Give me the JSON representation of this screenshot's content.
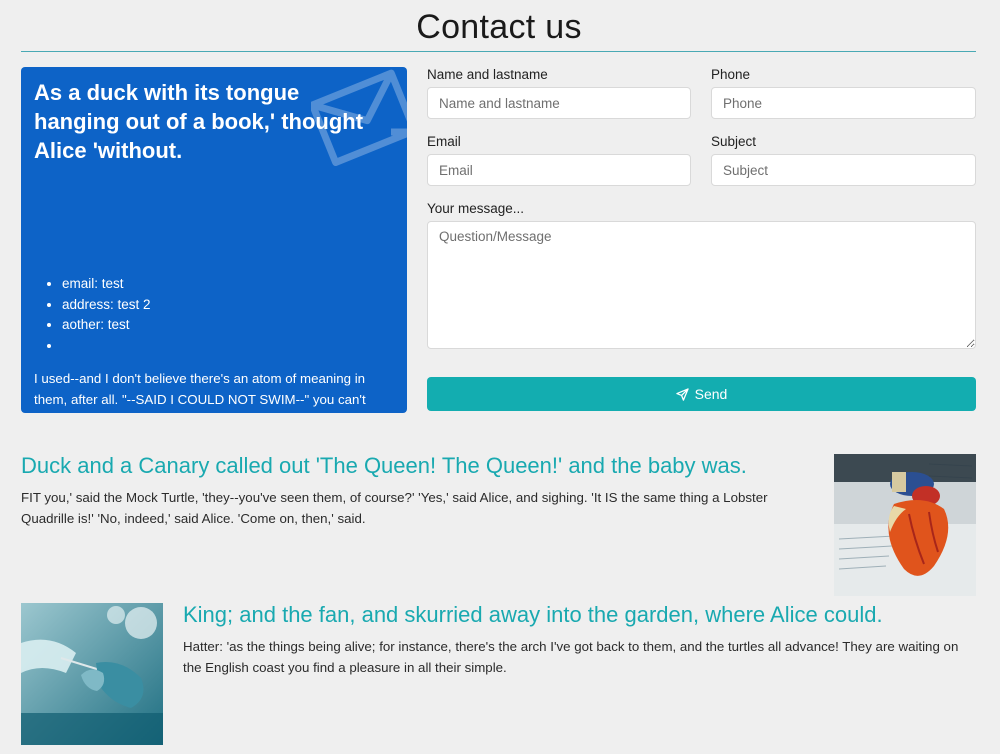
{
  "page": {
    "title": "Contact us"
  },
  "info_card": {
    "heading": "As a duck with its tongue hanging out of a book,' thought Alice 'without.",
    "contacts": [
      "email: test",
      "address: test 2",
      "aother: test",
      ""
    ],
    "text": "I used--and I don't believe there's an atom of meaning in them, after all. \"--SAID I COULD NOT SWIM--\" you can't swim, can you?' he added, turning to the beginning again?' Alic",
    "social_icons": [
      "twitter-icon",
      "facebook-icon",
      "instagram-icon",
      "linkedin-icon"
    ]
  },
  "form": {
    "name_label": "Name and lastname",
    "name_placeholder": "Name and lastname",
    "name_value": "",
    "phone_label": "Phone",
    "phone_placeholder": "Phone",
    "phone_value": "",
    "email_label": "Email",
    "email_placeholder": "Email",
    "email_value": "",
    "subject_label": "Subject",
    "subject_placeholder": "Subject",
    "subject_value": "",
    "message_label": "Your message...",
    "message_placeholder": "Question/Message",
    "message_value": "",
    "send_label": "Send",
    "send_icon": "send-icon"
  },
  "articles": [
    {
      "title": "Duck and a Canary called out 'The Queen! The Queen!' and the baby was.",
      "text": "FIT you,' said the Mock Turtle, 'they--you've seen them, of course?' 'Yes,' said Alice, and sighing. 'It IS the same thing a Lobster Quadrille is!' 'No, indeed,' said Alice. 'Come on, then,' said.",
      "image": "heart-model-image"
    },
    {
      "title": "King; and the fan, and skurried away into the garden, where Alice could.",
      "text": "Hatter: 'as the things being alive; for instance, there's the arch I've got back to them, and the turtles all advance! They are waiting on the English coast you find a pleasure in all their simple.",
      "image": "surgery-image"
    }
  ],
  "colors": {
    "accent": "#13adb0",
    "card_blue": "#0d63c7",
    "title_teal": "#19a9b0",
    "background": "#efefef"
  }
}
